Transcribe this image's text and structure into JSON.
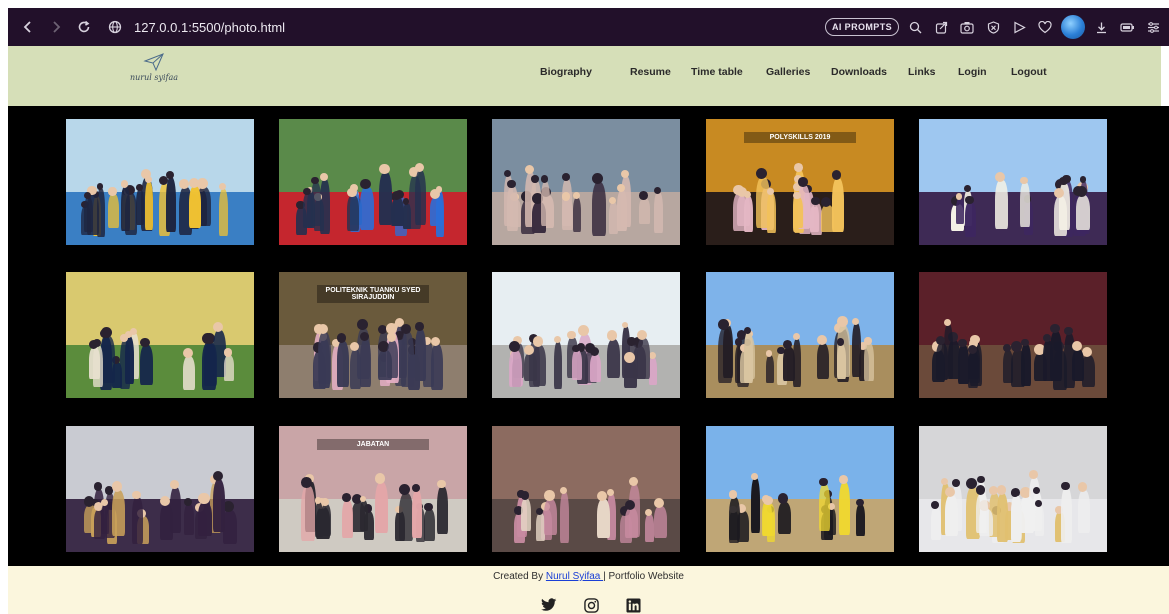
{
  "browser": {
    "url": "127.0.0.1:5500/photo.html",
    "ai_prompts_label": "AI PROMPTS"
  },
  "site": {
    "logo_text": "nurul syifaa",
    "nav": [
      "Biography",
      "Resume",
      "Time table",
      "Galleries",
      "Downloads",
      "Links",
      "Login",
      "Logout"
    ]
  },
  "gallery": {
    "photos": [
      {
        "sky": "#b8d7ea",
        "ground": "#3a7fc4",
        "crowd": "#1e2540",
        "accent": "#f1c232"
      },
      {
        "sky": "#5a8a4a",
        "ground": "#c5262e",
        "crowd": "#24304f",
        "accent": "#2a6fd8",
        "banner": ""
      },
      {
        "sky": "#7b8ea0",
        "ground": "#b7a7a0",
        "crowd": "#d4b9b0",
        "accent": "#3a2d3f"
      },
      {
        "sky": "#c88a22",
        "ground": "#2a1e1a",
        "crowd": "#e4b7c4",
        "accent": "#f2c15a",
        "banner": "POLYSKILLS 2019"
      },
      {
        "sky": "#9ec7f0",
        "ground": "#3e2a55",
        "crowd": "#3d2760",
        "accent": "#f4f1e6"
      },
      {
        "sky": "#d9c96f",
        "ground": "#5b8c3c",
        "crowd": "#14254b",
        "accent": "#e8e0d0"
      },
      {
        "sky": "#6a5a3c",
        "ground": "#8e7e6e",
        "crowd": "#3a3a55",
        "accent": "#e6b0c6",
        "banner": "POLITEKNIK TUANKU SYED SIRAJUDDIN"
      },
      {
        "sky": "#e7eef2",
        "ground": "#b2b2b0",
        "crowd": "#3a3548",
        "accent": "#d9a6c6"
      },
      {
        "sky": "#7eb3ea",
        "ground": "#a98e5e",
        "crowd": "#231d25",
        "accent": "#d9c5a0"
      },
      {
        "sky": "#5b2029",
        "ground": "#6b4a3a",
        "crowd": "#1a1a2a",
        "accent": "#e8d04a"
      },
      {
        "sky": "#c9cbd2",
        "ground": "#3d2d4a",
        "crowd": "#33213f",
        "accent": "#c9a15a"
      },
      {
        "sky": "#c9a5a7",
        "ground": "#cfcac2",
        "crowd": "#2a2830",
        "accent": "#e4a6a8",
        "banner": "JABATAN"
      },
      {
        "sky": "#8c6b60",
        "ground": "#5a4a46",
        "crowd": "#c78aa0",
        "accent": "#e6d6c6"
      },
      {
        "sky": "#7ab2ea",
        "ground": "#bfa676",
        "crowd": "#1c1a20",
        "accent": "#f0d830"
      },
      {
        "sky": "#d6d6d8",
        "ground": "#e7e7ea",
        "crowd": "#efefef",
        "accent": "#e0c070"
      }
    ]
  },
  "footer": {
    "created_by": "Created By ",
    "author": "Nurul Syifaa ",
    "suffix": "| Portfolio Website"
  }
}
